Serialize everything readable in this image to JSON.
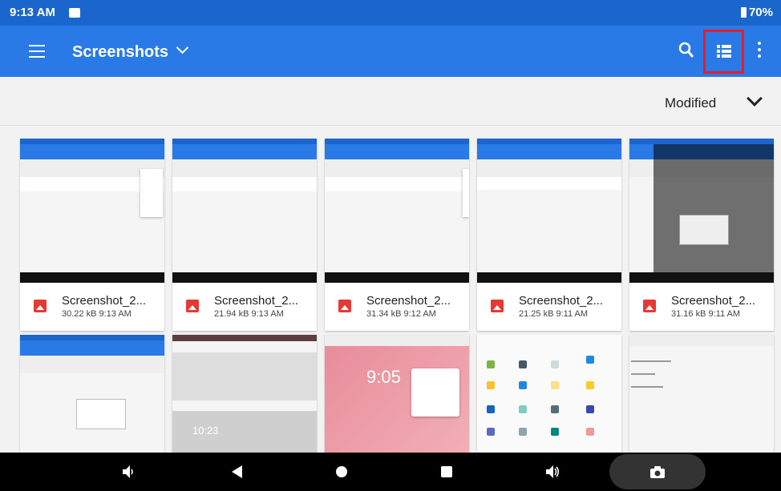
{
  "status": {
    "time": "9:13 AM",
    "battery": "70%"
  },
  "appbar": {
    "title": "Screenshots"
  },
  "sort": {
    "label": "Modified"
  },
  "files": [
    {
      "name": "Screenshot_2...",
      "detail": "30.22 kB 9:13 AM"
    },
    {
      "name": "Screenshot_2...",
      "detail": "21.94 kB 9:13 AM"
    },
    {
      "name": "Screenshot_2...",
      "detail": "31.34 kB 9:12 AM"
    },
    {
      "name": "Screenshot_2...",
      "detail": "21.25 kB 9:11 AM"
    },
    {
      "name": "Screenshot_2...",
      "detail": "31.16 kB 9:11 AM"
    }
  ],
  "previews": {
    "clock": "9:05",
    "clock2": "10:23"
  },
  "colors": {
    "appbar": "#2979e6",
    "statusbar": "#1a66cc",
    "highlight": "#e41e2b",
    "file_icon": "#e53935"
  },
  "icons": [
    "menu-icon",
    "dropdown-icon",
    "search-icon",
    "list-view-icon",
    "more-icon",
    "chevron-down-icon",
    "image-file-icon",
    "volume-down-icon",
    "back-icon",
    "home-icon",
    "recents-icon",
    "volume-up-icon",
    "camera-icon"
  ]
}
